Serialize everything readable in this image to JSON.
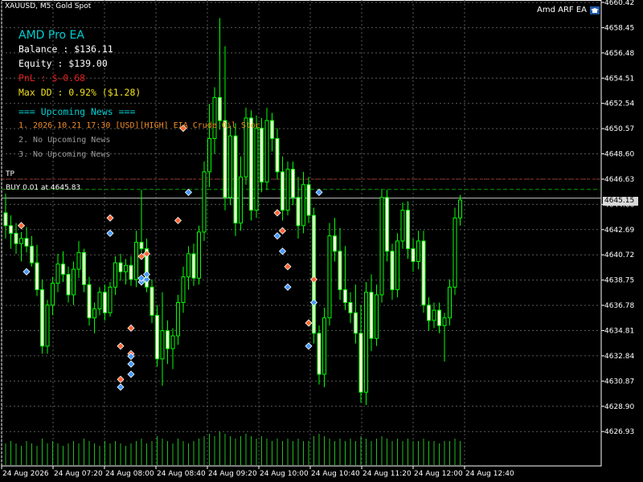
{
  "window": {
    "symbol_title": "XAUUSD, M5:  Gold Spot",
    "ea_name": "Amd ARF EA"
  },
  "panel": {
    "title": "AMD Pro EA",
    "balance": "Balance : $136.11",
    "equity": "Equity : $139.00",
    "pnl": "PnL : $-0.68",
    "max_dd": "Max DD : 0.92% ($1.28)",
    "news_title": "=== Upcoming News ===",
    "news": [
      "1. 2026.10.21 17:30 [USD][HIGH] EIA Crude Oil Stoc",
      "2. No Upcoming News",
      "3. No Upcoming News"
    ]
  },
  "lines": {
    "tp_label": "TP",
    "buy_label": "BUY 0.01 at 4645.83",
    "current_price": "4645.15"
  },
  "axis": {
    "price_labels": [
      "4660.42",
      "4658.45",
      "4656.48",
      "4654.51",
      "4652.54",
      "4650.57",
      "4648.60",
      "4646.63",
      "4644.66",
      "4642.69",
      "4640.72",
      "4638.75",
      "4636.78",
      "4634.81",
      "4632.84",
      "4630.87",
      "4628.90",
      "4626.93"
    ],
    "time_labels": [
      "24 Aug 2026",
      "24 Aug 07:20",
      "24 Aug 08:00",
      "24 Aug 08:40",
      "24 Aug 09:20",
      "24 Aug 10:00",
      "24 Aug 10:40",
      "24 Aug 11:20",
      "24 Aug 12:00",
      "24 Aug 12:40"
    ]
  },
  "chart_data": {
    "type": "candlestick",
    "symbol": "XAUUSD",
    "timeframe": "M5",
    "ylim": [
      4625.5,
      4660.42
    ],
    "tp_price": 4646.63,
    "buy_price": 4645.83,
    "current_price": 4645.15,
    "candles": [
      {
        "o": 4644.0,
        "h": 4645.5,
        "l": 4642.0,
        "c": 4643.0
      },
      {
        "o": 4643.0,
        "h": 4643.8,
        "l": 4641.2,
        "c": 4642.4
      },
      {
        "o": 4642.4,
        "h": 4643.2,
        "l": 4640.8,
        "c": 4641.6
      },
      {
        "o": 4641.6,
        "h": 4642.5,
        "l": 4640.2,
        "c": 4642.0
      },
      {
        "o": 4642.0,
        "h": 4642.9,
        "l": 4640.9,
        "c": 4641.4
      },
      {
        "o": 4641.4,
        "h": 4642.2,
        "l": 4639.8,
        "c": 4640.1
      },
      {
        "o": 4640.1,
        "h": 4641.5,
        "l": 4637.5,
        "c": 4638.0
      },
      {
        "o": 4638.0,
        "h": 4638.8,
        "l": 4633.0,
        "c": 4633.6
      },
      {
        "o": 4633.6,
        "h": 4637.2,
        "l": 4633.0,
        "c": 4636.8
      },
      {
        "o": 4636.8,
        "h": 4639.0,
        "l": 4636.0,
        "c": 4638.5
      },
      {
        "o": 4638.5,
        "h": 4640.8,
        "l": 4637.8,
        "c": 4640.0
      },
      {
        "o": 4640.0,
        "h": 4641.0,
        "l": 4638.6,
        "c": 4639.2
      },
      {
        "o": 4639.2,
        "h": 4639.8,
        "l": 4637.0,
        "c": 4637.6
      },
      {
        "o": 4637.6,
        "h": 4640.2,
        "l": 4636.8,
        "c": 4639.6
      },
      {
        "o": 4639.6,
        "h": 4641.8,
        "l": 4638.9,
        "c": 4640.9
      },
      {
        "o": 4640.9,
        "h": 4641.2,
        "l": 4637.8,
        "c": 4638.4
      },
      {
        "o": 4638.4,
        "h": 4639.0,
        "l": 4635.2,
        "c": 4635.8
      },
      {
        "o": 4635.8,
        "h": 4637.0,
        "l": 4634.6,
        "c": 4636.5
      },
      {
        "o": 4636.5,
        "h": 4638.2,
        "l": 4636.0,
        "c": 4637.8
      },
      {
        "o": 4637.8,
        "h": 4638.4,
        "l": 4635.6,
        "c": 4636.2
      },
      {
        "o": 4636.2,
        "h": 4638.6,
        "l": 4635.9,
        "c": 4638.2
      },
      {
        "o": 4638.2,
        "h": 4640.6,
        "l": 4637.6,
        "c": 4640.1
      },
      {
        "o": 4640.1,
        "h": 4640.8,
        "l": 4638.7,
        "c": 4639.4
      },
      {
        "o": 4639.4,
        "h": 4640.4,
        "l": 4638.4,
        "c": 4639.9
      },
      {
        "o": 4639.9,
        "h": 4640.6,
        "l": 4638.3,
        "c": 4638.8
      },
      {
        "o": 4638.8,
        "h": 4642.6,
        "l": 4638.2,
        "c": 4641.7
      },
      {
        "o": 4641.7,
        "h": 4645.8,
        "l": 4640.9,
        "c": 4641.2
      },
      {
        "o": 4641.2,
        "h": 4642.0,
        "l": 4637.8,
        "c": 4638.2
      },
      {
        "o": 4638.2,
        "h": 4638.8,
        "l": 4635.4,
        "c": 4636.0
      },
      {
        "o": 4636.0,
        "h": 4636.8,
        "l": 4632.0,
        "c": 4632.6
      },
      {
        "o": 4632.6,
        "h": 4637.8,
        "l": 4630.5,
        "c": 4634.8
      },
      {
        "o": 4634.8,
        "h": 4635.6,
        "l": 4632.2,
        "c": 4633.4
      },
      {
        "o": 4633.4,
        "h": 4635.0,
        "l": 4631.8,
        "c": 4634.4
      },
      {
        "o": 4634.4,
        "h": 4637.6,
        "l": 4633.7,
        "c": 4637.0
      },
      {
        "o": 4637.0,
        "h": 4639.8,
        "l": 4636.2,
        "c": 4639.0
      },
      {
        "o": 4639.0,
        "h": 4641.4,
        "l": 4638.0,
        "c": 4640.8
      },
      {
        "o": 4640.8,
        "h": 4641.6,
        "l": 4638.3,
        "c": 4638.9
      },
      {
        "o": 4638.9,
        "h": 4643.0,
        "l": 4638.4,
        "c": 4642.5
      },
      {
        "o": 4642.5,
        "h": 4648.0,
        "l": 4641.8,
        "c": 4647.2
      },
      {
        "o": 4647.2,
        "h": 4652.5,
        "l": 4646.0,
        "c": 4649.8
      },
      {
        "o": 4649.8,
        "h": 4653.8,
        "l": 4648.6,
        "c": 4653.0
      },
      {
        "o": 4653.0,
        "h": 4659.2,
        "l": 4650.5,
        "c": 4651.2
      },
      {
        "o": 4651.2,
        "h": 4657.0,
        "l": 4644.2,
        "c": 4645.2
      },
      {
        "o": 4645.2,
        "h": 4650.8,
        "l": 4644.6,
        "c": 4650.0
      },
      {
        "o": 4650.0,
        "h": 4651.0,
        "l": 4642.2,
        "c": 4643.2
      },
      {
        "o": 4643.2,
        "h": 4648.4,
        "l": 4642.6,
        "c": 4646.8
      },
      {
        "o": 4646.8,
        "h": 4652.2,
        "l": 4646.2,
        "c": 4651.4
      },
      {
        "o": 4651.4,
        "h": 4652.0,
        "l": 4643.4,
        "c": 4644.2
      },
      {
        "o": 4644.2,
        "h": 4651.6,
        "l": 4643.6,
        "c": 4650.6
      },
      {
        "o": 4650.6,
        "h": 4651.4,
        "l": 4645.6,
        "c": 4646.4
      },
      {
        "o": 4646.4,
        "h": 4652.2,
        "l": 4645.8,
        "c": 4651.2
      },
      {
        "o": 4651.2,
        "h": 4651.8,
        "l": 4648.8,
        "c": 4649.8
      },
      {
        "o": 4649.8,
        "h": 4650.6,
        "l": 4646.6,
        "c": 4647.2
      },
      {
        "o": 4647.2,
        "h": 4648.4,
        "l": 4643.4,
        "c": 4644.2
      },
      {
        "o": 4644.2,
        "h": 4648.0,
        "l": 4643.8,
        "c": 4647.4
      },
      {
        "o": 4647.4,
        "h": 4648.0,
        "l": 4644.6,
        "c": 4645.2
      },
      {
        "o": 4645.2,
        "h": 4646.8,
        "l": 4642.0,
        "c": 4643.0
      },
      {
        "o": 4643.0,
        "h": 4647.2,
        "l": 4642.4,
        "c": 4646.2
      },
      {
        "o": 4646.2,
        "h": 4646.8,
        "l": 4643.2,
        "c": 4643.8
      },
      {
        "o": 4643.8,
        "h": 4644.4,
        "l": 4633.8,
        "c": 4634.6
      },
      {
        "o": 4634.6,
        "h": 4635.2,
        "l": 4630.6,
        "c": 4631.4
      },
      {
        "o": 4631.4,
        "h": 4636.6,
        "l": 4630.4,
        "c": 4635.8
      },
      {
        "o": 4635.8,
        "h": 4643.2,
        "l": 4635.2,
        "c": 4642.2
      },
      {
        "o": 4642.2,
        "h": 4643.6,
        "l": 4640.2,
        "c": 4641.0
      },
      {
        "o": 4641.0,
        "h": 4642.8,
        "l": 4637.2,
        "c": 4638.0
      },
      {
        "o": 4638.0,
        "h": 4641.4,
        "l": 4636.4,
        "c": 4637.0
      },
      {
        "o": 4637.0,
        "h": 4637.8,
        "l": 4635.4,
        "c": 4636.2
      },
      {
        "o": 4636.2,
        "h": 4638.4,
        "l": 4633.8,
        "c": 4634.6
      },
      {
        "o": 4634.6,
        "h": 4636.8,
        "l": 4629.2,
        "c": 4630.0
      },
      {
        "o": 4630.0,
        "h": 4638.6,
        "l": 4629.0,
        "c": 4637.8
      },
      {
        "o": 4637.8,
        "h": 4639.2,
        "l": 4633.2,
        "c": 4634.2
      },
      {
        "o": 4634.2,
        "h": 4638.4,
        "l": 4633.6,
        "c": 4637.6
      },
      {
        "o": 4637.6,
        "h": 4645.8,
        "l": 4637.0,
        "c": 4645.2
      },
      {
        "o": 4645.2,
        "h": 4645.8,
        "l": 4640.2,
        "c": 4641.0
      },
      {
        "o": 4641.0,
        "h": 4641.6,
        "l": 4637.2,
        "c": 4638.0
      },
      {
        "o": 4638.0,
        "h": 4642.4,
        "l": 4637.4,
        "c": 4641.8
      },
      {
        "o": 4641.8,
        "h": 4644.8,
        "l": 4641.2,
        "c": 4644.2
      },
      {
        "o": 4644.2,
        "h": 4644.9,
        "l": 4640.4,
        "c": 4641.2
      },
      {
        "o": 4641.2,
        "h": 4642.0,
        "l": 4639.4,
        "c": 4640.2
      },
      {
        "o": 4640.2,
        "h": 4642.6,
        "l": 4639.6,
        "c": 4641.8
      },
      {
        "o": 4641.8,
        "h": 4642.6,
        "l": 4636.2,
        "c": 4636.8
      },
      {
        "o": 4636.8,
        "h": 4637.4,
        "l": 4634.8,
        "c": 4635.6
      },
      {
        "o": 4635.6,
        "h": 4637.0,
        "l": 4635.0,
        "c": 4636.4
      },
      {
        "o": 4636.4,
        "h": 4637.0,
        "l": 4634.6,
        "c": 4635.2
      },
      {
        "o": 4635.2,
        "h": 4636.2,
        "l": 4632.4,
        "c": 4635.8
      },
      {
        "o": 4635.8,
        "h": 4638.8,
        "l": 4635.2,
        "c": 4638.2
      },
      {
        "o": 4638.2,
        "h": 4644.4,
        "l": 4637.6,
        "c": 4643.6
      },
      {
        "o": 4643.6,
        "h": 4645.4,
        "l": 4643.0,
        "c": 4645.0
      }
    ],
    "volume": [
      9,
      10,
      9,
      8,
      10,
      9,
      8,
      11,
      9,
      10,
      9,
      8,
      9,
      10,
      9,
      11,
      10,
      9,
      8,
      10,
      9,
      10,
      9,
      8,
      9,
      10,
      11,
      9,
      10,
      12,
      11,
      10,
      9,
      11,
      10,
      9,
      10,
      11,
      12,
      13,
      12,
      14,
      13,
      12,
      11,
      12,
      13,
      12,
      11,
      12,
      11,
      10,
      11,
      10,
      11,
      10,
      11,
      10,
      10,
      12,
      13,
      12,
      11,
      10,
      11,
      10,
      11,
      10,
      12,
      11,
      10,
      11,
      12,
      11,
      10,
      11,
      10,
      11,
      10,
      10,
      11,
      10,
      10,
      9,
      10,
      10,
      11,
      10
    ],
    "signals": [
      {
        "i": 3,
        "side": "sell",
        "price": 4643.0
      },
      {
        "i": 4,
        "side": "buy",
        "price": 4639.4
      },
      {
        "i": 20,
        "side": "sell",
        "price": 4643.6
      },
      {
        "i": 20,
        "side": "buy",
        "price": 4642.4
      },
      {
        "i": 22,
        "side": "sell",
        "price": 4633.6
      },
      {
        "i": 22,
        "side": "sell",
        "price": 4631.0
      },
      {
        "i": 22,
        "side": "buy",
        "price": 4630.4
      },
      {
        "i": 24,
        "side": "sell",
        "price": 4633.0
      },
      {
        "i": 24,
        "side": "sell",
        "price": 4635.0
      },
      {
        "i": 24,
        "side": "buy",
        "price": 4632.8
      },
      {
        "i": 24,
        "side": "buy",
        "price": 4632.2
      },
      {
        "i": 24,
        "side": "buy",
        "price": 4631.4
      },
      {
        "i": 26,
        "side": "sell",
        "price": 4640.6
      },
      {
        "i": 26,
        "side": "buy",
        "price": 4638.6
      },
      {
        "i": 26,
        "side": "buy",
        "price": 4638.9
      },
      {
        "i": 27,
        "side": "sell",
        "price": 4640.8
      },
      {
        "i": 27,
        "side": "buy",
        "price": 4638.8
      },
      {
        "i": 27,
        "side": "buy",
        "price": 4639.2
      },
      {
        "i": 33,
        "side": "sell",
        "price": 4643.4
      },
      {
        "i": 35,
        "side": "buy",
        "price": 4645.6
      },
      {
        "i": 34,
        "side": "sell",
        "price": 4650.6
      },
      {
        "i": 52,
        "side": "sell",
        "price": 4644.0
      },
      {
        "i": 52,
        "side": "buy",
        "price": 4642.2
      },
      {
        "i": 53,
        "side": "sell",
        "price": 4642.6
      },
      {
        "i": 53,
        "side": "buy",
        "price": 4641.0
      },
      {
        "i": 54,
        "side": "sell",
        "price": 4639.8
      },
      {
        "i": 54,
        "side": "buy",
        "price": 4638.2
      },
      {
        "i": 58,
        "side": "sell",
        "price": 4635.4
      },
      {
        "i": 58,
        "side": "buy",
        "price": 4633.6
      },
      {
        "i": 59,
        "side": "sell",
        "price": 4638.8
      },
      {
        "i": 59,
        "side": "buy",
        "price": 4637.0
      },
      {
        "i": 60,
        "side": "buy",
        "price": 4645.6
      }
    ]
  },
  "colors": {
    "background": "#000000",
    "candle_bull_fill": "#000000",
    "candle_bear_fill": "#ffffdc",
    "candle_stroke": "#00ff00",
    "grid": "#5a5a5a",
    "tp_line": "#a03030",
    "buy_line": "#00a000",
    "price_line": "#c0c0c0",
    "panel_title": "#00ced1",
    "panel_text": "#ffffff",
    "pnl": "#e0201c",
    "max_dd": "#f0e020",
    "news_high": "#f08c28",
    "news_none": "#9a9a9a",
    "sell_marker": "#ff6633",
    "buy_marker": "#4499ff"
  }
}
